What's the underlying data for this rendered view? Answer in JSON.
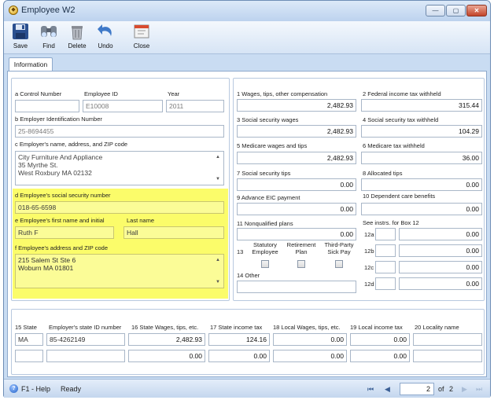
{
  "window": {
    "title": "Employee W2",
    "minimize": "—",
    "maximize": "▢",
    "close": "✕"
  },
  "toolbar": {
    "save": "Save",
    "find": "Find",
    "delete": "Delete",
    "undo": "Undo",
    "close": "Close"
  },
  "tabs": {
    "information": "Information"
  },
  "left": {
    "control_label": "a  Control Number",
    "control_value": "",
    "empid_label": "Employee ID",
    "empid_value": "E10008",
    "year_label": "Year",
    "year_value": "2011",
    "ein_label": "b  Employer Identification Number",
    "ein_value": "25-8694455",
    "employer_label": "c  Employer's name, address, and ZIP code",
    "employer_lines": [
      "City Furniture And Appliance",
      "35 Myrthe St.",
      "West Roxbury MA 02132"
    ],
    "ssn_label": "d  Employee's social security number",
    "ssn_value": "018-65-6598",
    "first_label": "e  Employee's first name and initial",
    "first_value": "Ruth F",
    "last_label": "Last name",
    "last_value": "Hall",
    "addr_label": "f  Employee's address and ZIP code",
    "addr_lines": [
      "215 Salem St Ste 6",
      "Woburn MA 01801"
    ]
  },
  "right": {
    "b1_label": "1  Wages, tips, other compensation",
    "b1_value": "2,482.93",
    "b2_label": "2  Federal income tax withheld",
    "b2_value": "315.44",
    "b3_label": "3  Social security wages",
    "b3_value": "2,482.93",
    "b4_label": "4  Social security tax withheld",
    "b4_value": "104.29",
    "b5_label": "5  Medicare wages and tips",
    "b5_value": "2,482.93",
    "b6_label": "6  Medicare tax withheld",
    "b6_value": "36.00",
    "b7_label": "7  Social security tips",
    "b7_value": "0.00",
    "b8_label": "8  Allocated tips",
    "b8_value": "0.00",
    "b9_label": "9  Advance EIC payment",
    "b9_value": "0.00",
    "b10_label": "10  Dependent care benefits",
    "b10_value": "0.00",
    "b11_label": "11  Nonqualified plans",
    "b11_value": "0.00",
    "b12_label": "See instrs. for Box 12",
    "b12": [
      {
        "code": "12a",
        "value": "0.00"
      },
      {
        "code": "12b",
        "value": "0.00"
      },
      {
        "code": "12c",
        "value": "0.00"
      },
      {
        "code": "12d",
        "value": "0.00"
      }
    ],
    "b13_label": "13",
    "b13_stat": [
      "Statutory",
      "Employee"
    ],
    "b13_ret": [
      "Retirement",
      "Plan"
    ],
    "b13_sick": [
      "Third-Party",
      "Sick Pay"
    ],
    "b14_label": "14  Other",
    "b14_value": ""
  },
  "bottom": {
    "h15": "15  State",
    "h15b": "Employer's state ID number",
    "h16": "16  State Wages, tips, etc.",
    "h17": "17  State income tax",
    "h18": "18  Local Wages, tips, etc.",
    "h19": "19  Local income tax",
    "h20": "20  Locality name",
    "rows": [
      {
        "state": "MA",
        "id": "85-4262149",
        "wages": "2,482.93",
        "tax": "124.16",
        "local_wages": "0.00",
        "local_tax": "0.00",
        "locality": ""
      },
      {
        "state": "",
        "id": "",
        "wages": "0.00",
        "tax": "0.00",
        "local_wages": "0.00",
        "local_tax": "0.00",
        "locality": ""
      }
    ]
  },
  "status": {
    "help": "F1 - Help",
    "ready": "Ready",
    "page": "2",
    "of": "of",
    "total": "2"
  }
}
